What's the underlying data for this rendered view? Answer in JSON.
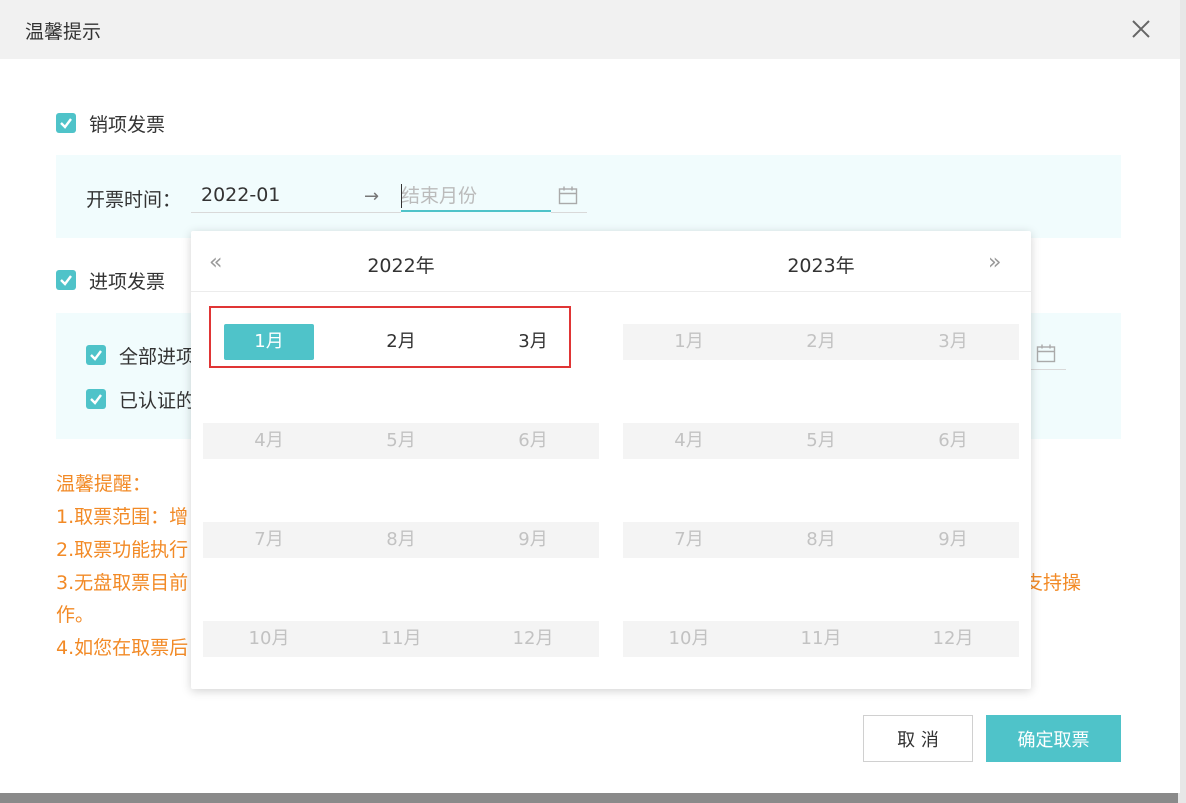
{
  "dialog": {
    "title": "温馨提示",
    "close_icon": "close-icon"
  },
  "sales": {
    "label": "销项发票",
    "checked": true,
    "date_label": "开票时间：",
    "start_value": "2022-01",
    "range_separator": "→",
    "end_placeholder": "结束月份"
  },
  "purchase": {
    "label": "进项发票",
    "checked": true,
    "options": [
      "全部进项",
      "已认证的"
    ]
  },
  "notice": {
    "title": "温馨提醒：",
    "lines": [
      "1.取票范围：增",
      "2.取票功能执行",
      "3.无盘取票目前",
      "作。",
      "4.如您在取票后"
    ],
    "tail_text": "支持操"
  },
  "buttons": {
    "cancel": "取 消",
    "confirm": "确定取票"
  },
  "picker": {
    "prev_icon": "«",
    "next_icon": "»",
    "left_year": "2022年",
    "right_year": "2023年",
    "months": [
      "1月",
      "2月",
      "3月",
      "4月",
      "5月",
      "6月",
      "7月",
      "8月",
      "9月",
      "10月",
      "11月",
      "12月"
    ],
    "selected_month": "1月",
    "enabled_left_months": [
      "1月",
      "2月",
      "3月"
    ]
  },
  "colors": {
    "accent": "#4fc3c9",
    "notice": "#f28a26",
    "highlight": "#e03535"
  }
}
